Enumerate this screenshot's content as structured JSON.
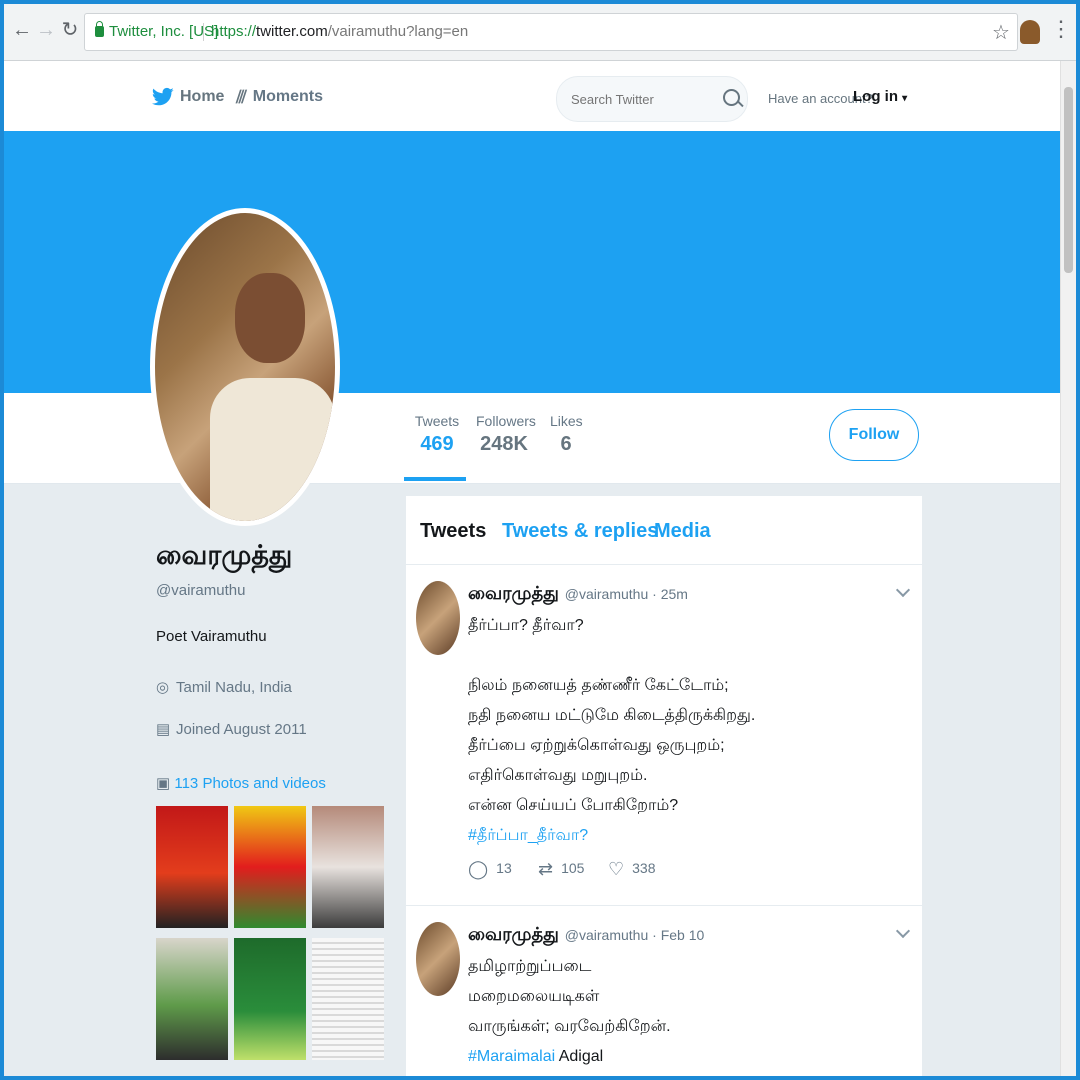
{
  "browser": {
    "site_identity": "Twitter, Inc. [US]",
    "url_scheme": "https://",
    "url_host": "twitter.com",
    "url_rest": "/vairamuthu?lang=en"
  },
  "nav": {
    "home": "Home",
    "moments": "Moments",
    "search_placeholder": "Search Twitter",
    "have_account": "Have an account?",
    "login": "Log in"
  },
  "profile": {
    "name": "வைரமுத்து",
    "handle": "@vairamuthu",
    "bio": "Poet Vairamuthu",
    "location": "Tamil Nadu, India",
    "joined": "Joined August 2011",
    "photos_link": "113 Photos and videos",
    "follow": "Follow"
  },
  "stats": {
    "tweets_label": "Tweets",
    "tweets": "469",
    "followers_label": "Followers",
    "followers": "248K",
    "likes_label": "Likes",
    "likes": "6"
  },
  "tabs": [
    "Tweets",
    "Tweets & replies",
    "Media"
  ],
  "tweets": [
    {
      "name": "வைரமுத்து",
      "handle_time": "@vairamuthu · 25m",
      "lines": [
        "தீர்ப்பா? தீர்வா?",
        "",
        "நிலம் நனையத் தண்ணீர் கேட்டோம்;",
        "நதி நனைய மட்டுமே கிடைத்திருக்கிறது.",
        "தீர்ப்பை ஏற்றுக்கொள்வது ஒருபுறம்;",
        "எதிர்கொள்வது மறுபுறம்.",
        "என்ன செய்யப் போகிறோம்?"
      ],
      "hashtag": "#தீர்ப்பா_தீர்வா?",
      "replies": "13",
      "retweets": "105",
      "likes": "338"
    },
    {
      "name": "வைரமுத்து",
      "handle_time": "@vairamuthu · Feb 10",
      "lines": [
        "தமிழாற்றுப்படை",
        "மறைமலையடிகள்",
        "வாருங்கள்; வரவேற்கிறேன்."
      ],
      "hashtag": "#Maraimalai",
      "hashtag_suffix": " Adigal"
    }
  ],
  "colors": {
    "brand": "#1da1f2",
    "page_bg": "#e6ecf0"
  }
}
